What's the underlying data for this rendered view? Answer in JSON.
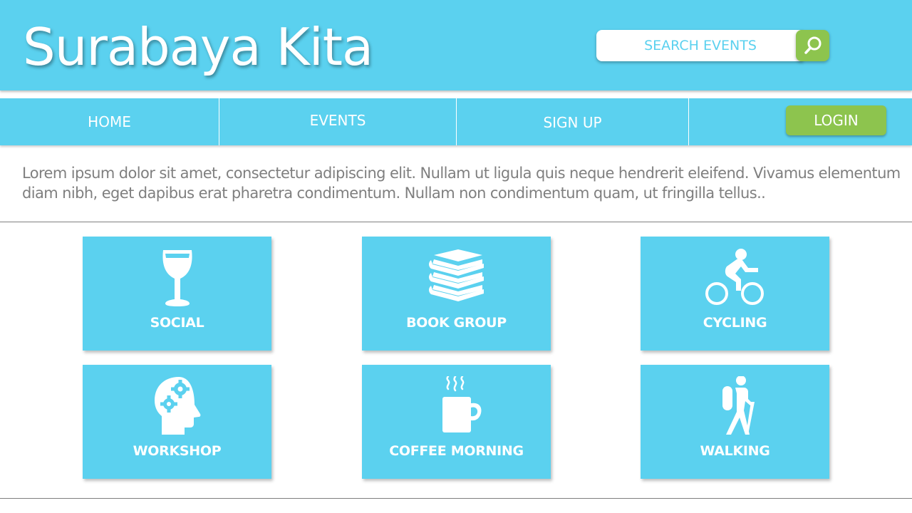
{
  "header": {
    "title": "Surabaya Kita",
    "search_placeholder": "SEARCH EVENTS",
    "search_icon": "search-icon"
  },
  "nav": {
    "items": [
      {
        "label": "HOME"
      },
      {
        "label": "EVENTS"
      },
      {
        "label": "SIGN UP"
      }
    ],
    "login_label": "LOGIN"
  },
  "intro": "Lorem ipsum dolor sit amet, consectetur adipiscing elit. Nullam ut ligula quis neque hendrerit eleifend. Vivamus elementum diam nibh, eget dapibus erat pharetra condimentum. Nullam non condimentum quam, ut fringilla tellus..",
  "categories": [
    {
      "label": "SOCIAL",
      "icon": "wine-glass-icon"
    },
    {
      "label": "BOOK GROUP",
      "icon": "books-icon"
    },
    {
      "label": "CYCLING",
      "icon": "cyclist-icon"
    },
    {
      "label": "WORKSHOP",
      "icon": "head-gears-icon"
    },
    {
      "label": "COFFEE MORNING",
      "icon": "coffee-mug-icon"
    },
    {
      "label": "WALKING",
      "icon": "hiker-icon"
    }
  ],
  "colors": {
    "primary": "#5bd1ef",
    "accent": "#8dc44e",
    "text_gray": "#7f7f7f"
  }
}
